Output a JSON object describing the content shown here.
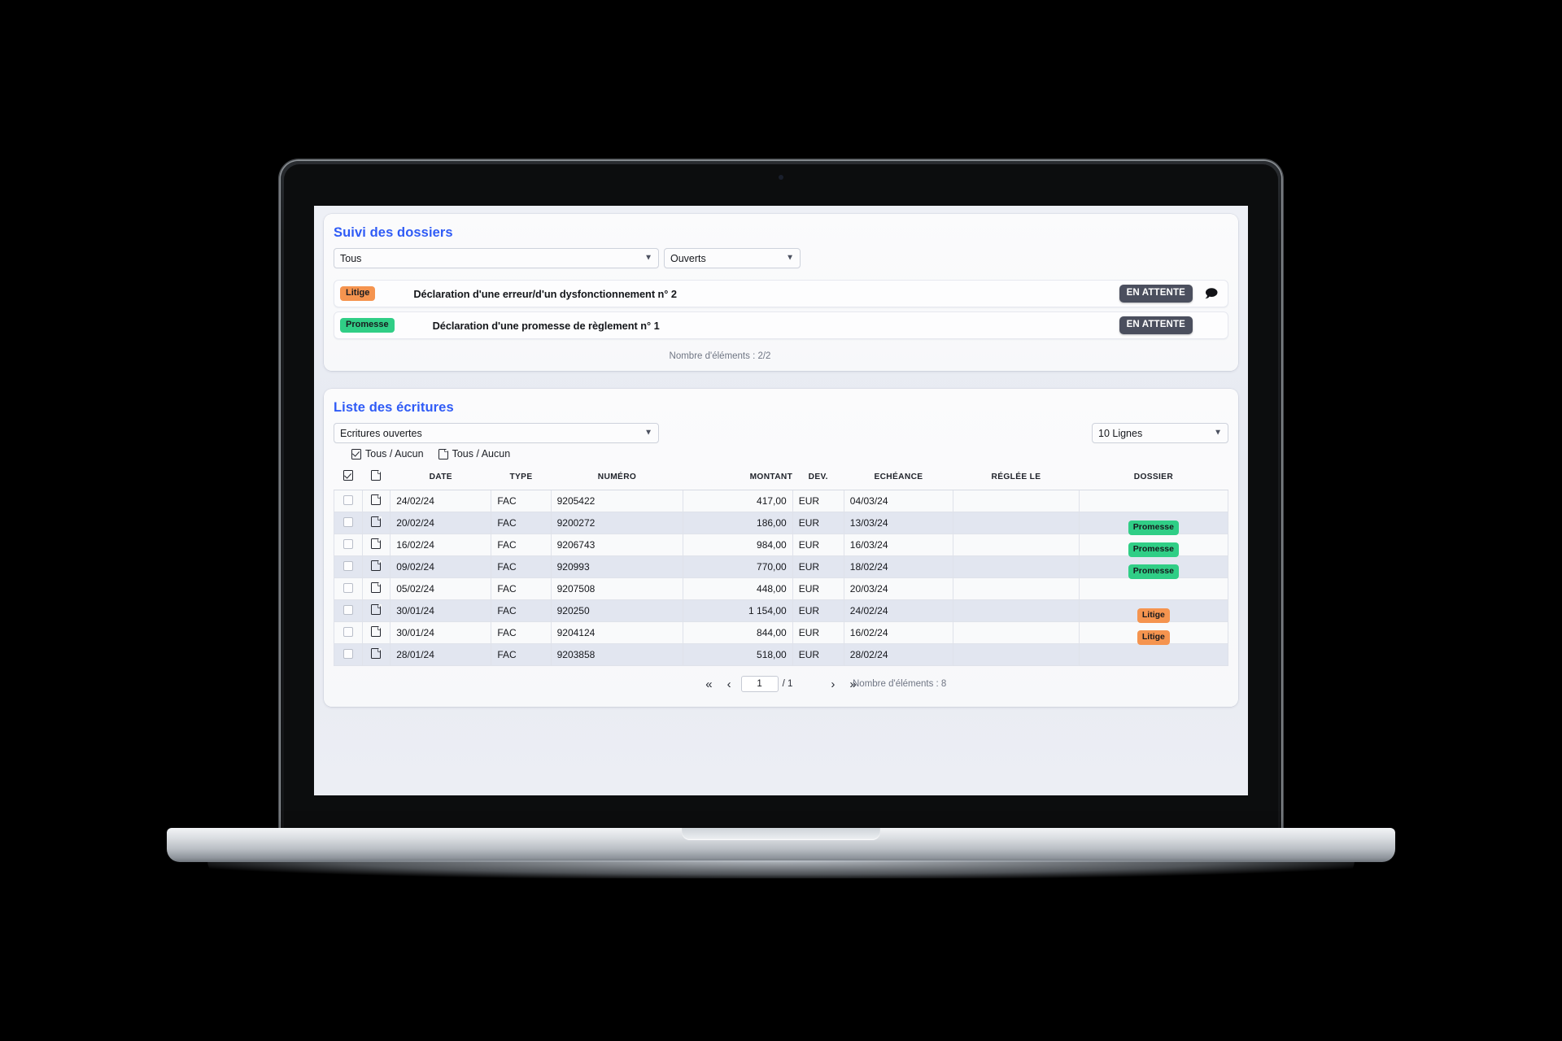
{
  "dossiers_panel": {
    "title": "Suivi des dossiers",
    "filter_type": {
      "value": "Tous",
      "icon": "chevron-down-icon"
    },
    "filter_state": {
      "value": "Ouverts",
      "icon": "chevron-down-icon"
    },
    "rows": [
      {
        "tag": "Litige",
        "tag_kind": "litige",
        "label": "Déclaration d'une erreur/d'un dysfonctionnement n° 2",
        "status": "EN ATTENTE",
        "comment_icon": "comment-bubble-icon",
        "has_comment": true
      },
      {
        "tag": "Promesse",
        "tag_kind": "promesse",
        "label": "Déclaration d'une promesse de règlement n° 1",
        "status": "EN ATTENTE",
        "comment_icon": "",
        "has_comment": false
      }
    ],
    "count_label": "Nombre d'éléments : 2/2"
  },
  "ecritures_panel": {
    "title": "Liste des écritures",
    "filter_state": {
      "value": "Ecritures ouvertes",
      "icon": "chevron-down-icon"
    },
    "rows_per_page": {
      "value": "10 Lignes",
      "icon": "chevron-down-icon"
    },
    "select_all_checkbox": {
      "label": "Tous / Aucun",
      "icon": "checkbox-checked-icon"
    },
    "select_all_pdf": {
      "label": "Tous / Aucun",
      "icon": "pdf-file-icon"
    },
    "headers": {
      "select": "",
      "pdf": "",
      "date": "DATE",
      "type": "TYPE",
      "numero": "NUMÉRO",
      "montant": "MONTANT",
      "devise": "DEV.",
      "echeance": "ECHÉANCE",
      "reglee_le": "RÉGLÉE LE",
      "dossier": "DOSSIER"
    },
    "rows": [
      {
        "date": "24/02/24",
        "type": "FAC",
        "numero": "9205422",
        "montant": "417,00",
        "devise": "EUR",
        "echeance": "04/03/24",
        "reglee_le": "",
        "dossier": "",
        "dossier_kind": ""
      },
      {
        "date": "20/02/24",
        "type": "FAC",
        "numero": "9200272",
        "montant": "186,00",
        "devise": "EUR",
        "echeance": "13/03/24",
        "reglee_le": "",
        "dossier": "Promesse",
        "dossier_kind": "promesse"
      },
      {
        "date": "16/02/24",
        "type": "FAC",
        "numero": "9206743",
        "montant": "984,00",
        "devise": "EUR",
        "echeance": "16/03/24",
        "reglee_le": "",
        "dossier": "Promesse",
        "dossier_kind": "promesse"
      },
      {
        "date": "09/02/24",
        "type": "FAC",
        "numero": "920993",
        "montant": "770,00",
        "devise": "EUR",
        "echeance": "18/02/24",
        "reglee_le": "",
        "dossier": "Promesse",
        "dossier_kind": "promesse"
      },
      {
        "date": "05/02/24",
        "type": "FAC",
        "numero": "9207508",
        "montant": "448,00",
        "devise": "EUR",
        "echeance": "20/03/24",
        "reglee_le": "",
        "dossier": "",
        "dossier_kind": ""
      },
      {
        "date": "30/01/24",
        "type": "FAC",
        "numero": "920250",
        "montant": "1 154,00",
        "devise": "EUR",
        "echeance": "24/02/24",
        "reglee_le": "",
        "dossier": "Litige",
        "dossier_kind": "litige"
      },
      {
        "date": "30/01/24",
        "type": "FAC",
        "numero": "9204124",
        "montant": "844,00",
        "devise": "EUR",
        "echeance": "16/02/24",
        "reglee_le": "",
        "dossier": "Litige",
        "dossier_kind": "litige"
      },
      {
        "date": "28/01/24",
        "type": "FAC",
        "numero": "9203858",
        "montant": "518,00",
        "devise": "EUR",
        "echeance": "28/02/24",
        "reglee_le": "",
        "dossier": "",
        "dossier_kind": ""
      }
    ],
    "pagination": {
      "first_icon": "«",
      "prev_icon": "‹",
      "page_value": "1",
      "total_pages": "/ 1",
      "next_icon": "›",
      "last_icon": "»",
      "count_label": "Nombre d'éléments : 8"
    }
  },
  "colors": {
    "accent_blue": "#2f5bf6",
    "tag_litige": "#f5944f",
    "tag_promesse": "#30ce86",
    "status_pill": "#4b4f5e",
    "page_bg": "#eceef4",
    "row_even": "#e2e6f0",
    "row_odd": "#f9fafb"
  }
}
